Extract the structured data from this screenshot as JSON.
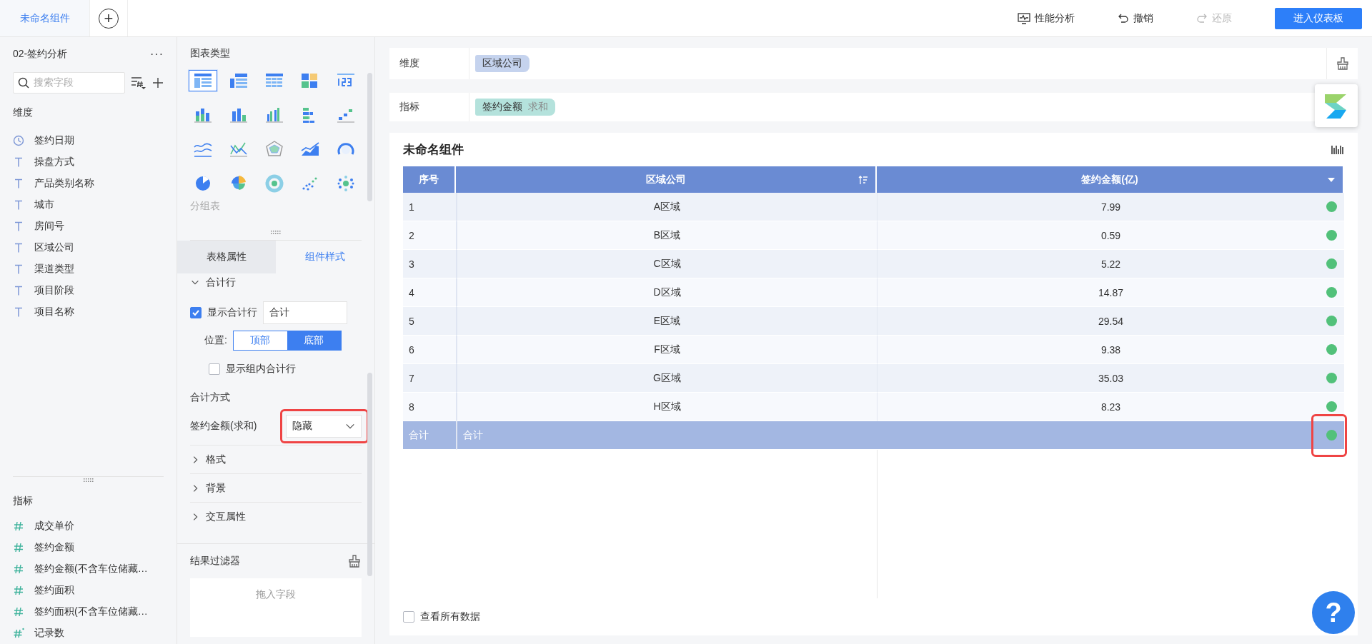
{
  "topbar": {
    "tabs": [
      {
        "label": "未命名组件",
        "selected": true
      }
    ],
    "add_button": {
      "label": "+"
    },
    "actions": [
      {
        "kind": "performance",
        "label": "性能分析",
        "disabled": false
      },
      {
        "kind": "undo",
        "label": "撤销",
        "disabled": false
      },
      {
        "kind": "redo",
        "label": "还原",
        "disabled": true
      }
    ],
    "primary_button": {
      "label": "进入仪表板"
    }
  },
  "fields_panel": {
    "dataset": "02-签约分析",
    "more": "···",
    "search": {
      "placeholder": "搜索字段"
    },
    "dimensions": {
      "title": "维度",
      "items": [
        {
          "kind": "date",
          "label": "签约日期"
        },
        {
          "kind": "text",
          "label": "操盘方式"
        },
        {
          "kind": "text",
          "label": "产品类别名称"
        },
        {
          "kind": "text",
          "label": "城市"
        },
        {
          "kind": "text",
          "label": "房间号"
        },
        {
          "kind": "text",
          "label": "区域公司"
        },
        {
          "kind": "text",
          "label": "渠道类型"
        },
        {
          "kind": "text",
          "label": "项目阶段"
        },
        {
          "kind": "text",
          "label": "项目名称"
        }
      ]
    },
    "metrics": {
      "title": "指标",
      "items": [
        {
          "kind": "number",
          "label": "成交单价"
        },
        {
          "kind": "number",
          "label": "签约金额"
        },
        {
          "kind": "number",
          "label": "签约金额(不含车位储藏…"
        },
        {
          "kind": "number",
          "label": "签约面积"
        },
        {
          "kind": "number",
          "label": "签约面积(不含车位储藏…"
        },
        {
          "kind": "calc",
          "label": "记录数"
        }
      ]
    }
  },
  "config_panel": {
    "chart_types": {
      "title": "图表类型",
      "hover_label": "分组表",
      "items": [
        {
          "kind": "table",
          "selected": true
        },
        {
          "kind": "cross-table",
          "selected": false
        },
        {
          "kind": "detail-table",
          "selected": false
        },
        {
          "kind": "heatmap",
          "selected": false
        },
        {
          "kind": "kpi",
          "selected": false
        },
        {
          "kind": "stacked-column",
          "selected": false
        },
        {
          "kind": "column",
          "selected": false
        },
        {
          "kind": "grouped-column",
          "selected": false
        },
        {
          "kind": "bar",
          "selected": false
        },
        {
          "kind": "waterfall",
          "selected": false
        },
        {
          "kind": "line",
          "selected": false
        },
        {
          "kind": "combo",
          "selected": false
        },
        {
          "kind": "radar",
          "selected": false
        },
        {
          "kind": "area",
          "selected": false
        },
        {
          "kind": "gauge",
          "selected": false
        },
        {
          "kind": "pie",
          "selected": false
        },
        {
          "kind": "rose",
          "selected": false
        },
        {
          "kind": "sunburst",
          "selected": false
        },
        {
          "kind": "scatter",
          "selected": false
        },
        {
          "kind": "bubble",
          "selected": false
        }
      ]
    },
    "tabs": [
      {
        "label": "表格属性",
        "selected": false
      },
      {
        "label": "组件样式",
        "selected": true
      }
    ],
    "total_row": {
      "title": "合计行",
      "expanded": true,
      "show": {
        "label": "显示合计行",
        "checked": true,
        "value": "合计"
      },
      "position": {
        "label": "位置:",
        "options": [
          {
            "label": "顶部",
            "selected": false
          },
          {
            "label": "底部",
            "selected": true
          }
        ]
      },
      "group_total": {
        "label": "显示组内合计行",
        "checked": false
      }
    },
    "total_method": {
      "title": "合计方式",
      "rows": [
        {
          "label": "签约金额(求和)",
          "value": "隐藏",
          "highlighted": true
        }
      ]
    },
    "sections": [
      {
        "label": "格式",
        "expanded": false
      },
      {
        "label": "背景",
        "expanded": false
      },
      {
        "label": "交互属性",
        "expanded": false
      }
    ],
    "result_filter": {
      "title": "结果过滤器",
      "dropzone": "拖入字段"
    }
  },
  "workspace": {
    "dimension_bar": {
      "label": "维度",
      "pills": [
        {
          "label": "区域公司"
        }
      ]
    },
    "metric_bar": {
      "label": "指标",
      "pills": [
        {
          "label": "签约金额",
          "aggregation": "求和"
        }
      ]
    },
    "component": {
      "title": "未命名组件",
      "table": {
        "columns": [
          {
            "label": "序号"
          },
          {
            "label": "区域公司"
          },
          {
            "label": "签约金额(亿)"
          }
        ],
        "rows": [
          [
            "1",
            "A区域",
            "7.99"
          ],
          [
            "2",
            "B区域",
            "0.59"
          ],
          [
            "3",
            "C区域",
            "5.22"
          ],
          [
            "4",
            "D区域",
            "14.87"
          ],
          [
            "5",
            "E区域",
            "29.54"
          ],
          [
            "6",
            "F区域",
            "9.38"
          ],
          [
            "7",
            "G区域",
            "35.03"
          ],
          [
            "8",
            "H区域",
            "8.23"
          ]
        ],
        "total_row": {
          "cells": [
            "合计",
            "合计"
          ],
          "highlighted": true
        }
      },
      "view_all": {
        "label": "查看所有数据",
        "checked": false
      }
    },
    "help_button": {
      "label": "?"
    }
  }
}
